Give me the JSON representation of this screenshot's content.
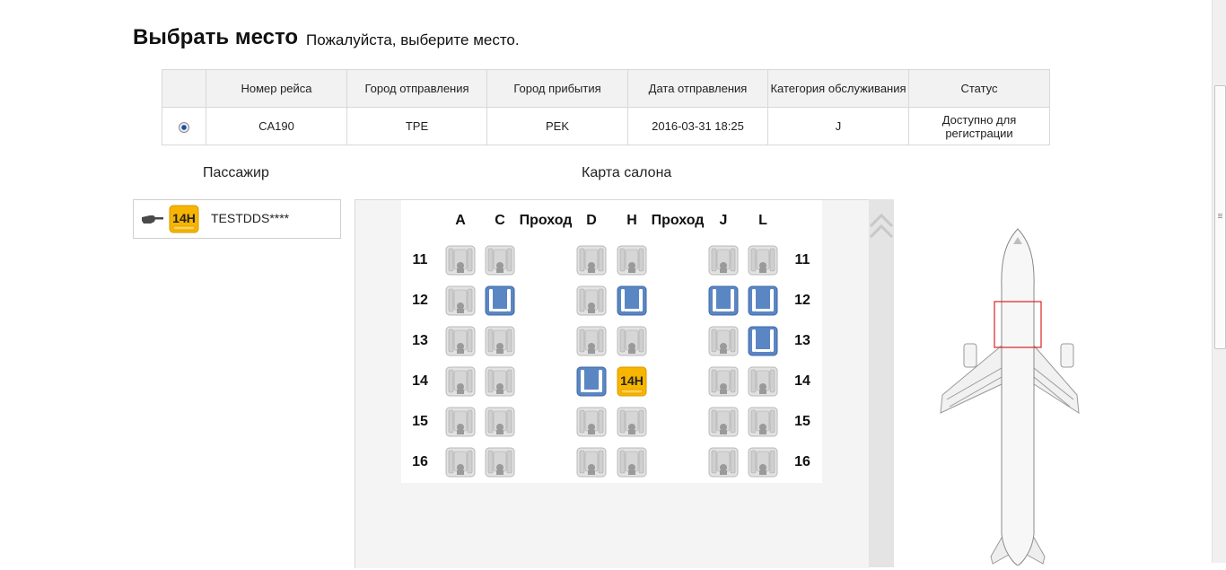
{
  "header": {
    "title": "Выбрать место",
    "subtitle": "Пожалуйста, выберите место."
  },
  "flights": {
    "columns": [
      "Номер рейса",
      "Город отправления",
      "Город прибытия",
      "Дата отправления",
      "Категория обслуживания",
      "Статус"
    ],
    "rows": [
      {
        "selected": true,
        "flight": "CA190",
        "from": "TPE",
        "to": "PEK",
        "date": "2016-03-31 18:25",
        "class": "J",
        "status": "Доступно для регистрации"
      }
    ]
  },
  "passenger_section": {
    "title": "Пассажир"
  },
  "passenger": {
    "seat": "14H",
    "name": "TESTDDS****"
  },
  "seat_map": {
    "title": "Карта салона",
    "columns": [
      "A",
      "C",
      "Проход",
      "D",
      "H",
      "Проход",
      "J",
      "L"
    ],
    "rows": [
      {
        "number": "11",
        "seats": [
          "occupied",
          "occupied",
          "occupied",
          "occupied",
          "occupied",
          "occupied"
        ]
      },
      {
        "number": "12",
        "seats": [
          "occupied",
          "available",
          "occupied",
          "available",
          "available",
          "available"
        ]
      },
      {
        "number": "13",
        "seats": [
          "occupied",
          "occupied",
          "occupied",
          "occupied",
          "occupied",
          "available"
        ]
      },
      {
        "number": "14",
        "seats": [
          "occupied",
          "occupied",
          "available",
          "selected",
          "occupied",
          "occupied"
        ]
      },
      {
        "number": "15",
        "seats": [
          "occupied",
          "occupied",
          "occupied",
          "occupied",
          "occupied",
          "occupied"
        ]
      },
      {
        "number": "16",
        "seats": [
          "occupied",
          "occupied",
          "occupied",
          "occupied",
          "occupied",
          "occupied"
        ]
      }
    ],
    "selected_label": "14H",
    "colors": {
      "occupied": "#cfcfcf",
      "available": "#5b86c4",
      "selected": "#f7b500"
    }
  },
  "icons": {
    "pointer": "hand-pointer-icon",
    "scroll_up": "double-chevron-up-icon",
    "airplane": "airplane-overview-icon"
  }
}
